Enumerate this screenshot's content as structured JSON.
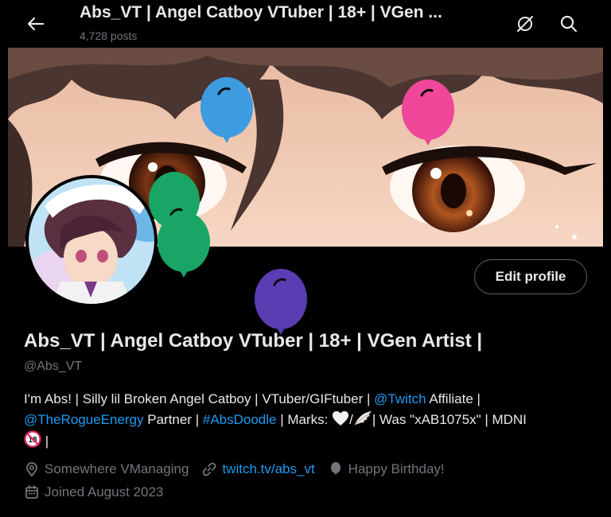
{
  "header": {
    "title": "Abs_VT | Angel Catboy VTuber | 18+ | VGen ...",
    "posts": "4,728 posts"
  },
  "profile": {
    "edit_button": "Edit profile",
    "display_name": "Abs_VT | Angel Catboy VTuber | 18+ | VGen Artist |",
    "handle": "@Abs_VT"
  },
  "bio": {
    "t1": "I'm Abs! | Silly lil Broken Angel Catboy | VTuber/GIFtuber | ",
    "mention_twitch": "@Twitch",
    "t2": " Affiliate | ",
    "mention_rogue": "@TheRogueEnergy",
    "t3": " Partner | ",
    "hashtag": "#AbsDoodle",
    "t4": " | Marks: ",
    "t5": "| Was \"xAB1075x\" | MDNI",
    "t6": " |"
  },
  "meta": {
    "location": "Somewhere VManaging",
    "website": "twitch.tv/abs_vt",
    "birthday": "Happy Birthday!",
    "joined": "Joined August 2023"
  },
  "colors": {
    "background": "#000000",
    "text": "#e7e9ea",
    "muted": "#71767b",
    "link": "#1d9bf0",
    "balloon_blue": "#3d9be0",
    "balloon_pink": "#f0479a",
    "balloon_green": "#19a566",
    "balloon_purple": "#5b3db3"
  },
  "icons": [
    "back-arrow-icon",
    "hide-icon",
    "search-icon",
    "location-icon",
    "link-icon",
    "balloon-icon",
    "calendar-icon"
  ]
}
